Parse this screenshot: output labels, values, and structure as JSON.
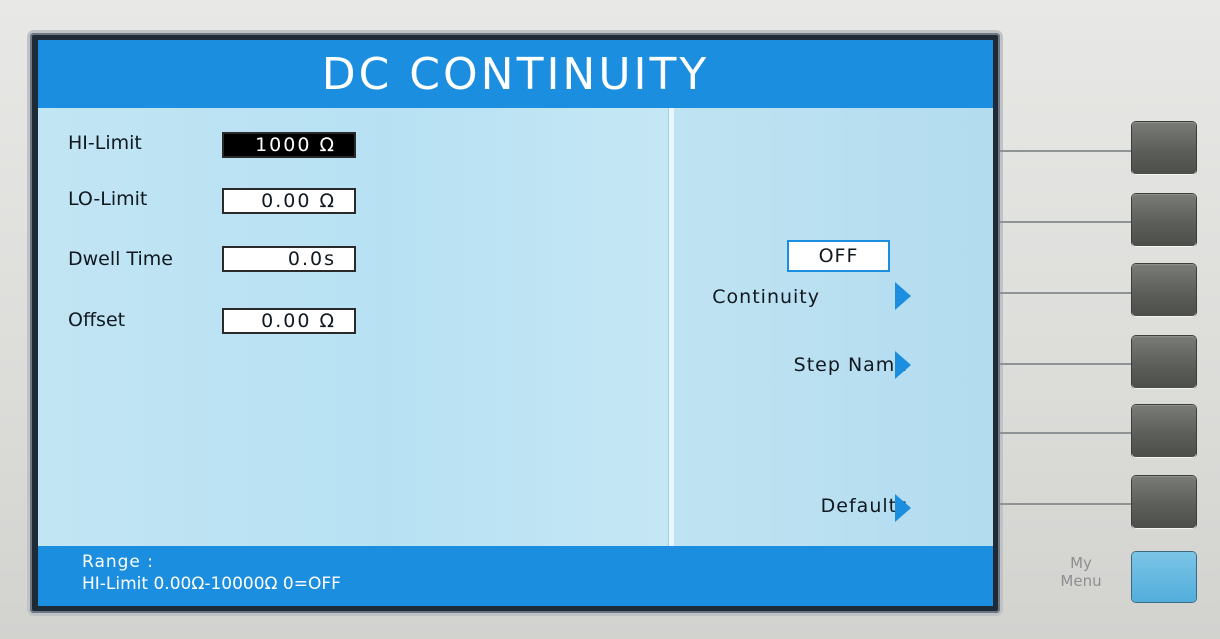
{
  "screen": {
    "title": "DC CONTINUITY",
    "params": [
      {
        "label": "HI-Limit",
        "value": "1000 Ω"
      },
      {
        "label": "LO-Limit",
        "value": "0.00 Ω"
      },
      {
        "label": "Dwell Time",
        "value": "0.0s"
      },
      {
        "label": "Offset",
        "value": "0.00 Ω"
      }
    ],
    "softkeys": {
      "continuity_label": "Continuity",
      "continuity_value": "OFF",
      "step_name": "Step Name",
      "defaults": "Defaults"
    },
    "status": {
      "line1": "Range :",
      "line2": "HI-Limit 0.00Ω-10000Ω 0=OFF"
    }
  },
  "panel": {
    "my_menu_label": "My Menu",
    "accent_color": "#1b8ee0",
    "screen_color": "#b9e2f2"
  }
}
